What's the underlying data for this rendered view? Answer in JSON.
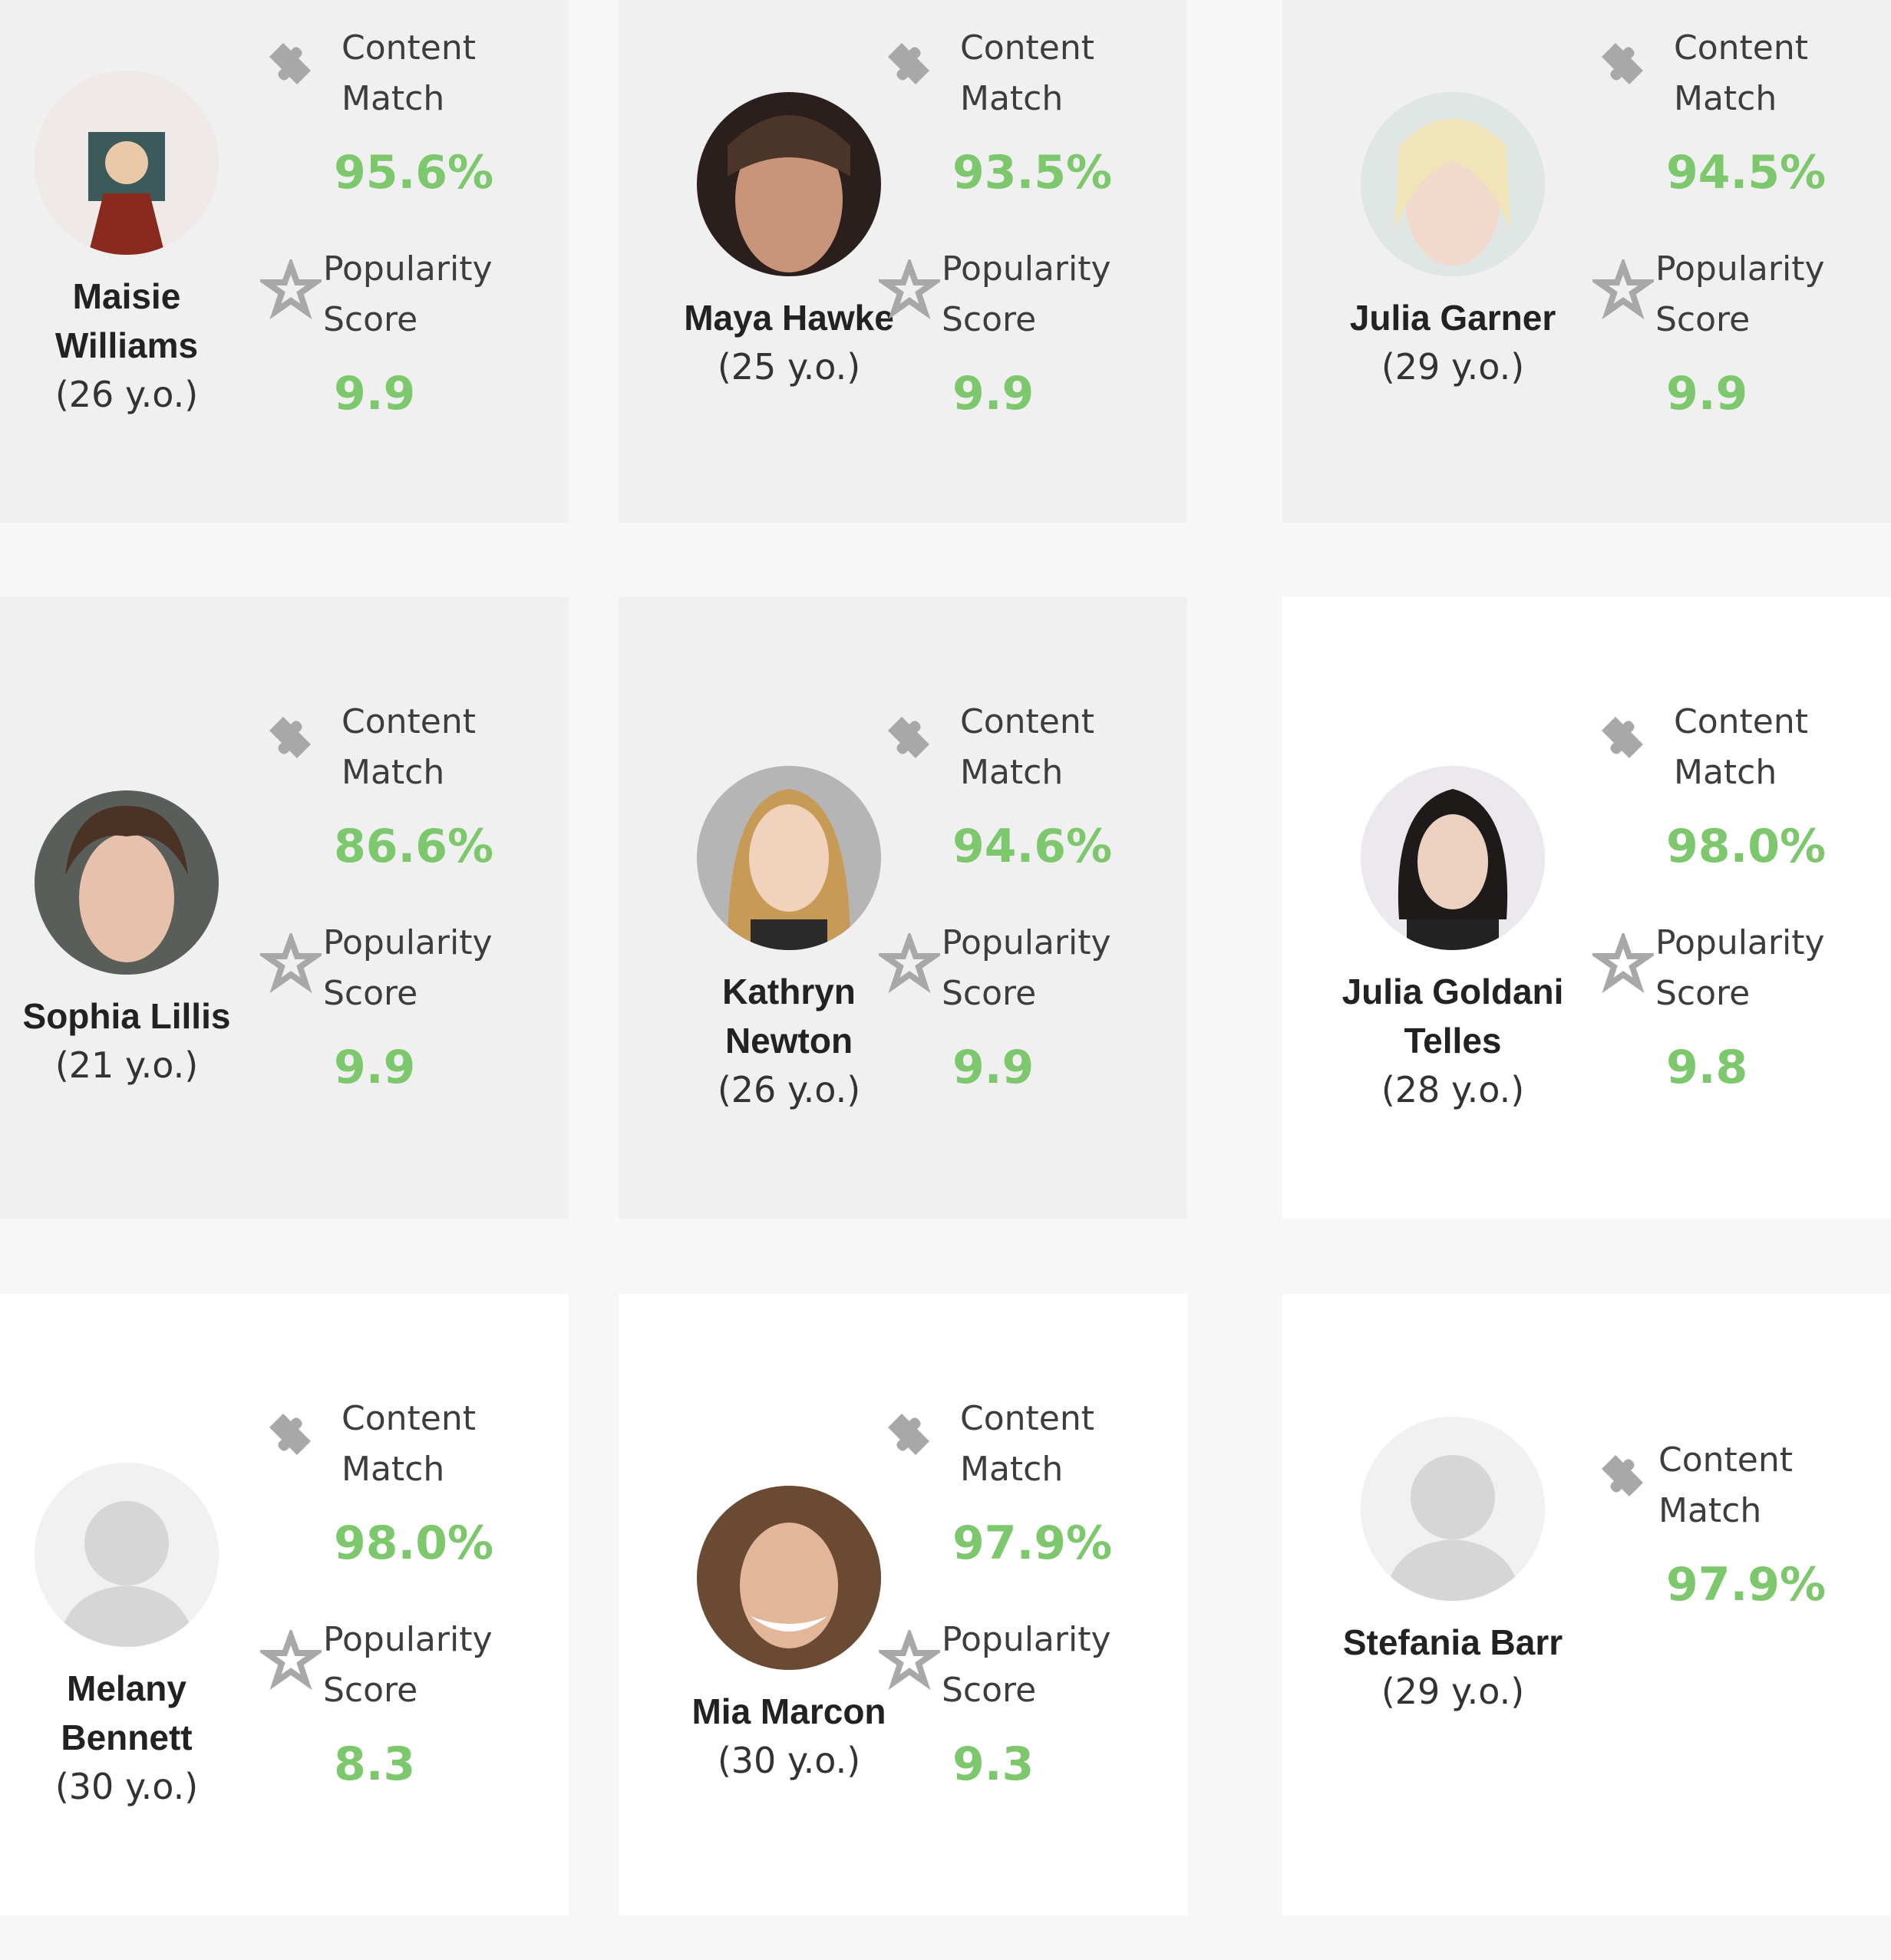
{
  "labels": {
    "content_line1": "Content",
    "content_line2": "Match",
    "popularity_line1": "Popularity",
    "popularity_line2": "Score"
  },
  "colors": {
    "value_green": "#7dc76c",
    "card_grey": "#f0f0f0",
    "card_white": "#ffffff"
  },
  "cards": [
    {
      "name_line1": "Maisie",
      "name_line2": "Williams",
      "age": "(26 y.o.)",
      "content_match": "95.6%",
      "popularity": "9.9",
      "avatar": "photo"
    },
    {
      "name_line1": "Maya Hawke",
      "name_line2": "",
      "age": "(25 y.o.)",
      "content_match": "93.5%",
      "popularity": "9.9",
      "avatar": "photo"
    },
    {
      "name_line1": "Julia Garner",
      "name_line2": "",
      "age": "(29 y.o.)",
      "content_match": "94.5%",
      "popularity": "9.9",
      "avatar": "photo"
    },
    {
      "name_line1": "Sophia Lillis",
      "name_line2": "",
      "age": "(21 y.o.)",
      "content_match": "86.6%",
      "popularity": "9.9",
      "avatar": "photo"
    },
    {
      "name_line1": "Kathryn",
      "name_line2": "Newton",
      "age": "(26 y.o.)",
      "content_match": "94.6%",
      "popularity": "9.9",
      "avatar": "photo"
    },
    {
      "name_line1": "Julia Goldani",
      "name_line2": "Telles",
      "age": "(28 y.o.)",
      "content_match": "98.0%",
      "popularity": "9.8",
      "avatar": "photo"
    },
    {
      "name_line1": "Melany",
      "name_line2": "Bennett",
      "age": "(30 y.o.)",
      "content_match": "98.0%",
      "popularity": "8.3",
      "avatar": "placeholder"
    },
    {
      "name_line1": "Mia Marcon",
      "name_line2": "",
      "age": "(30 y.o.)",
      "content_match": "97.9%",
      "popularity": "9.3",
      "avatar": "photo"
    },
    {
      "name_line1": "Stefania Barr",
      "name_line2": "",
      "age": "(29 y.o.)",
      "content_match": "97.9%",
      "popularity": "",
      "avatar": "placeholder"
    }
  ]
}
